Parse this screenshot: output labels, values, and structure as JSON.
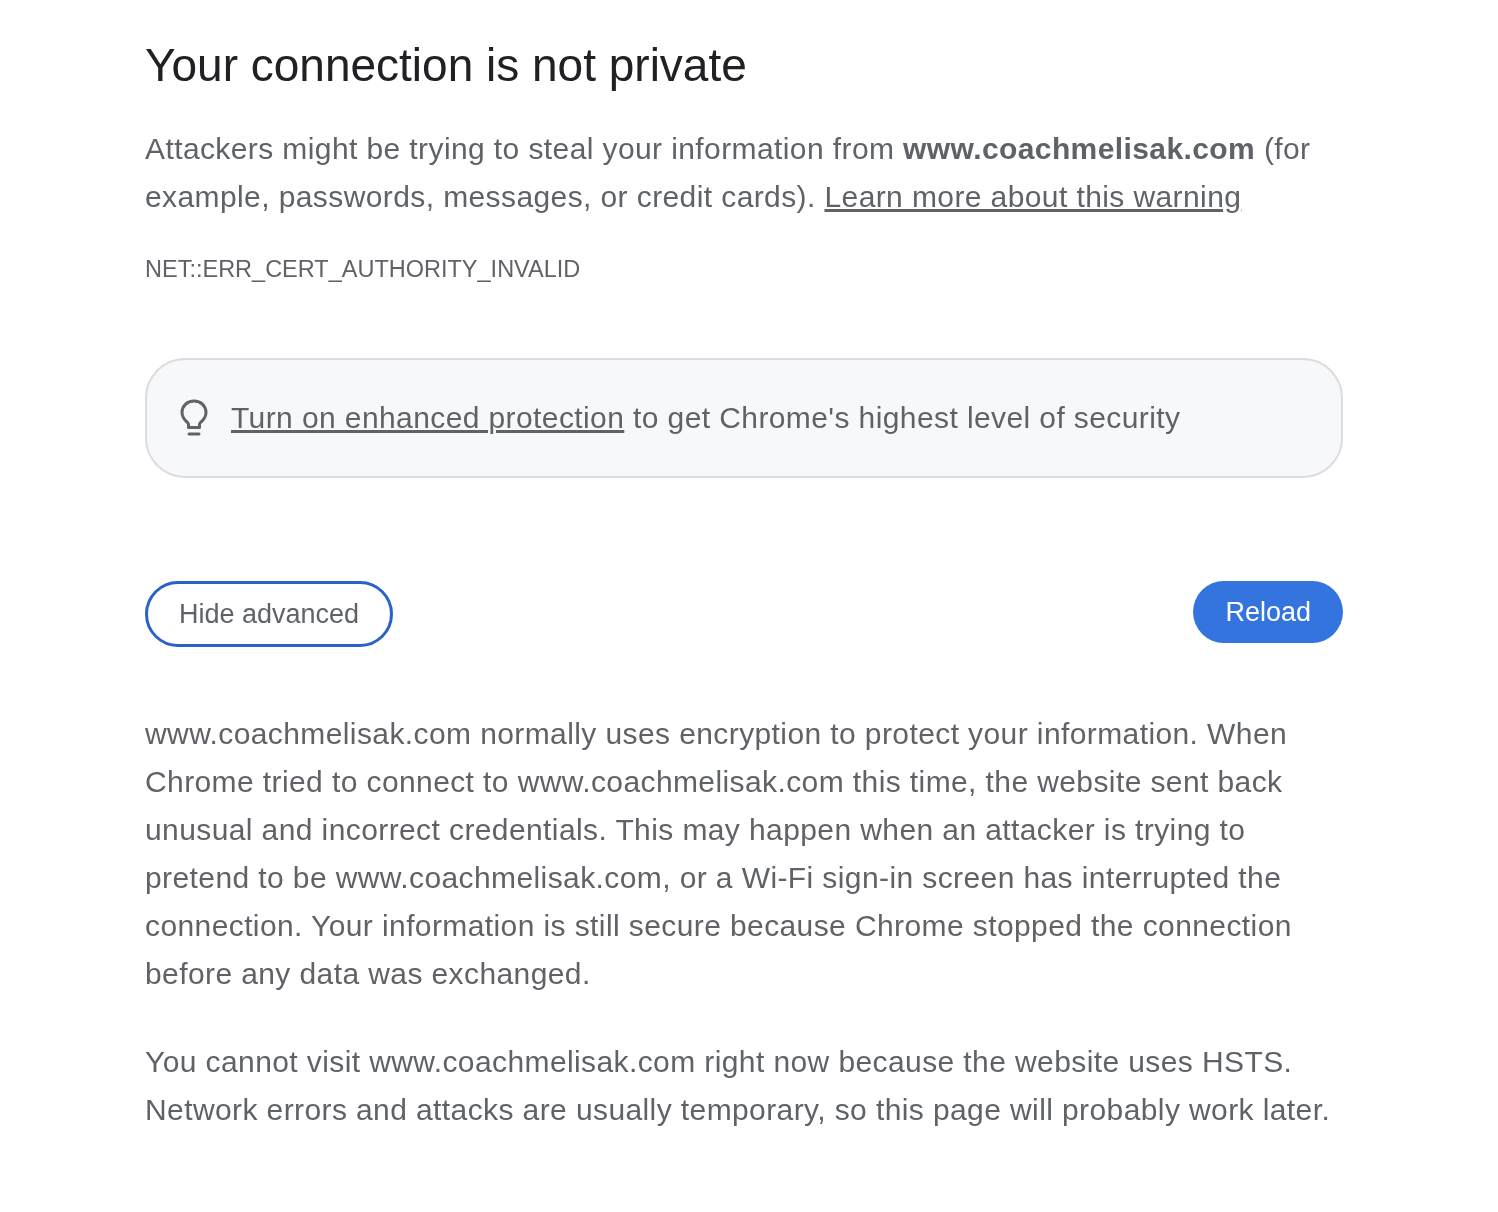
{
  "heading": "Your connection is not private",
  "intro": {
    "text": "Attackers might be trying to steal your information from **www.coachmelisak.com** (for example, passwords, messages, or credit cards).",
    "link": "Learn more about this warning"
  },
  "error_code": "NET::ERR_CERT_AUTHORITY_INVALID",
  "protection_banner": {
    "link": "Turn on enhanced protection",
    "text": "to get Chrome's highest level of security"
  },
  "buttons": [
    {
      "label": "Hide advanced",
      "kind": "outline"
    },
    {
      "label": "Reload",
      "kind": "primary"
    }
  ],
  "details": [
    "www.coachmelisak.com normally uses encryption to protect your information. When Chrome tried to connect to www.coachmelisak.com this time, the website sent back unusual and incorrect credentials. This may happen when an attacker is trying to pretend to be www.coachmelisak.com, or a Wi-Fi sign-in screen has interrupted the connection. Your information is still secure because Chrome stopped the connection before any data was exchanged.",
    "You cannot visit www.coachmelisak.com right now because the website uses HSTS. Network errors and attacks are usually temporary, so this page will probably work later."
  ]
}
